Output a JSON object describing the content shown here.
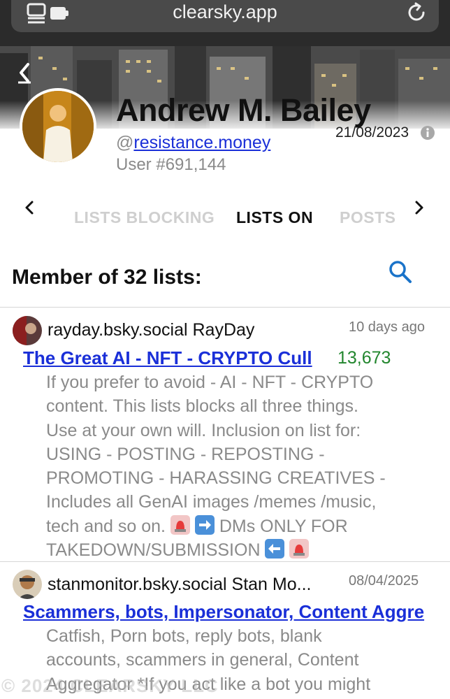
{
  "browser": {
    "url": "clearsky.app",
    "page_icon": "sidebar-tabs-icon",
    "reload_icon": "reload-icon"
  },
  "profile": {
    "display_name": "Andrew M. Bailey",
    "handle_prefix": "@",
    "handle": "resistance.money",
    "user_number": "User #691,144",
    "joined_date": "21/08/2023"
  },
  "tabs": {
    "items": [
      {
        "label": "LISTS BLOCKING",
        "active": false
      },
      {
        "label": "LISTS ON",
        "active": true
      },
      {
        "label": "POSTS",
        "active": false
      }
    ]
  },
  "members": {
    "title": "Member of 32 lists:"
  },
  "lists": [
    {
      "owner": "rayday.bsky.social RayDay",
      "date": "10 days ago",
      "name": "The Great AI - NFT - CRYPTO Cull",
      "count": "13,673",
      "description_lines": [
        "If you prefer to avoid - AI - NFT - CRYPTO",
        "content. This lists blocks all three things.",
        "Use at your own will. Inclusion on list for:",
        "USING - POSTING - REPOSTING -",
        "PROMOTING - HARASSING CREATIVES -",
        "Includes all GenAI images /memes /music,"
      ],
      "desc_line7_a": "tech and so on.",
      "desc_line7_b": "DMs ONLY FOR",
      "desc_line8": "TAKEDOWN/SUBMISSION"
    },
    {
      "owner": "stanmonitor.bsky.social Stan Mo...",
      "date": "08/04/2025",
      "name": "Scammers, bots, Impersonator, Content Aggre",
      "description_lines": [
        "Catfish, Porn bots, reply bots, blank",
        "accounts, scammers in general, Content",
        "Aggregator *If you act like a bot you might"
      ]
    }
  ],
  "watermark": "© 2024 CLEARSKY LLC",
  "colors": {
    "link": "#1a2fd8",
    "count": "#22862e",
    "muted": "#8a8a8a",
    "search": "#1a73c9"
  }
}
